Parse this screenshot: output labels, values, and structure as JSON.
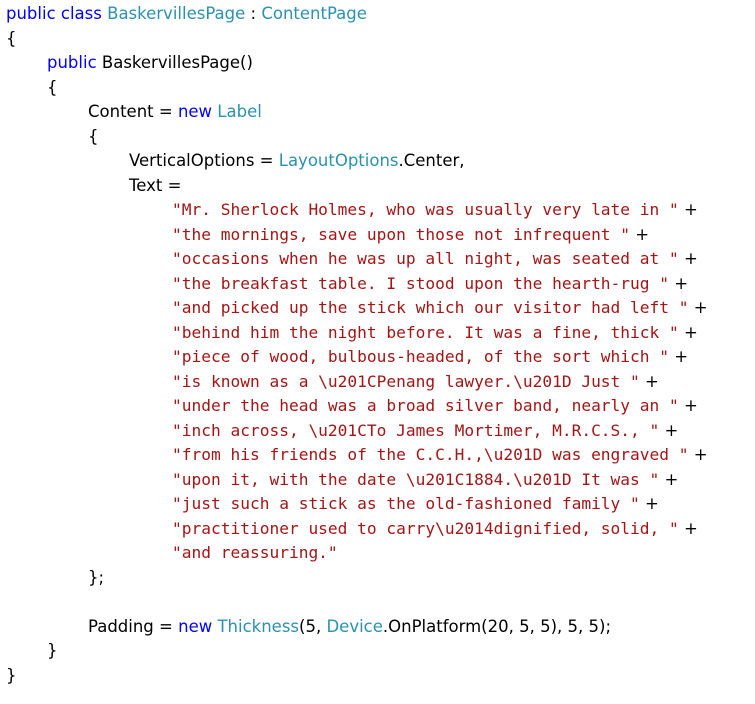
{
  "code": {
    "line1": {
      "kw1": "public",
      "kw2": "class",
      "class_name": "BaskervillesPage",
      "colon": " : ",
      "base_type": "ContentPage"
    },
    "brace_open_1": "{",
    "line3": {
      "kw": "public",
      "ctor": "BaskervillesPage()"
    },
    "brace_open_2": "{",
    "line5": {
      "lhs": "Content = ",
      "kw": "new",
      "type": "Label"
    },
    "brace_open_3": "{",
    "line7": {
      "prop": "VerticalOptions = ",
      "type": "LayoutOptions",
      "rest": ".Center,"
    },
    "line8": {
      "prop": "Text ="
    },
    "text_lines": [
      {
        "str": "\"Mr. Sherlock Holmes, who was usually very late in \"",
        "op": " +"
      },
      {
        "str": "\"the mornings, save upon those not infrequent \"",
        "op": " +"
      },
      {
        "str": "\"occasions when he was up all night, was seated at \"",
        "op": " +"
      },
      {
        "str": "\"the breakfast table. I stood upon the hearth-rug \"",
        "op": " +"
      },
      {
        "str": "\"and picked up the stick which our visitor had left \"",
        "op": " +"
      },
      {
        "str": "\"behind him the night before. It was a fine, thick \"",
        "op": " +"
      },
      {
        "str": "\"piece of wood, bulbous-headed, of the sort which \"",
        "op": " +"
      },
      {
        "str": "\"is known as a \\u201CPenang lawyer.\\u201D Just \"",
        "op": " +"
      },
      {
        "str": "\"under the head was a broad silver band, nearly an \"",
        "op": " +"
      },
      {
        "str": "\"inch across, \\u201CTo James Mortimer, M.R.C.S., \"",
        "op": " +"
      },
      {
        "str": "\"from his friends of the C.C.H.,\\u201D was engraved \"",
        "op": " +"
      },
      {
        "str": "\"upon it, with the date \\u201C1884.\\u201D It was \"",
        "op": " +"
      },
      {
        "str": "\"just such a stick as the old-fashioned family \"",
        "op": " +"
      },
      {
        "str": "\"practitioner used to carry\\u2014dignified, solid, \"",
        "op": " +"
      },
      {
        "str": "\"and reassuring.\"",
        "op": ""
      }
    ],
    "close_label": "};",
    "padding_line": {
      "lhs": "Padding = ",
      "kw": "new",
      "type1": "Thickness",
      "part1": "(5, ",
      "type2": "Device",
      "part2": ".OnPlatform(20, 5, 5), 5, 5);"
    },
    "brace_close_2": "}",
    "brace_close_1": "}"
  }
}
